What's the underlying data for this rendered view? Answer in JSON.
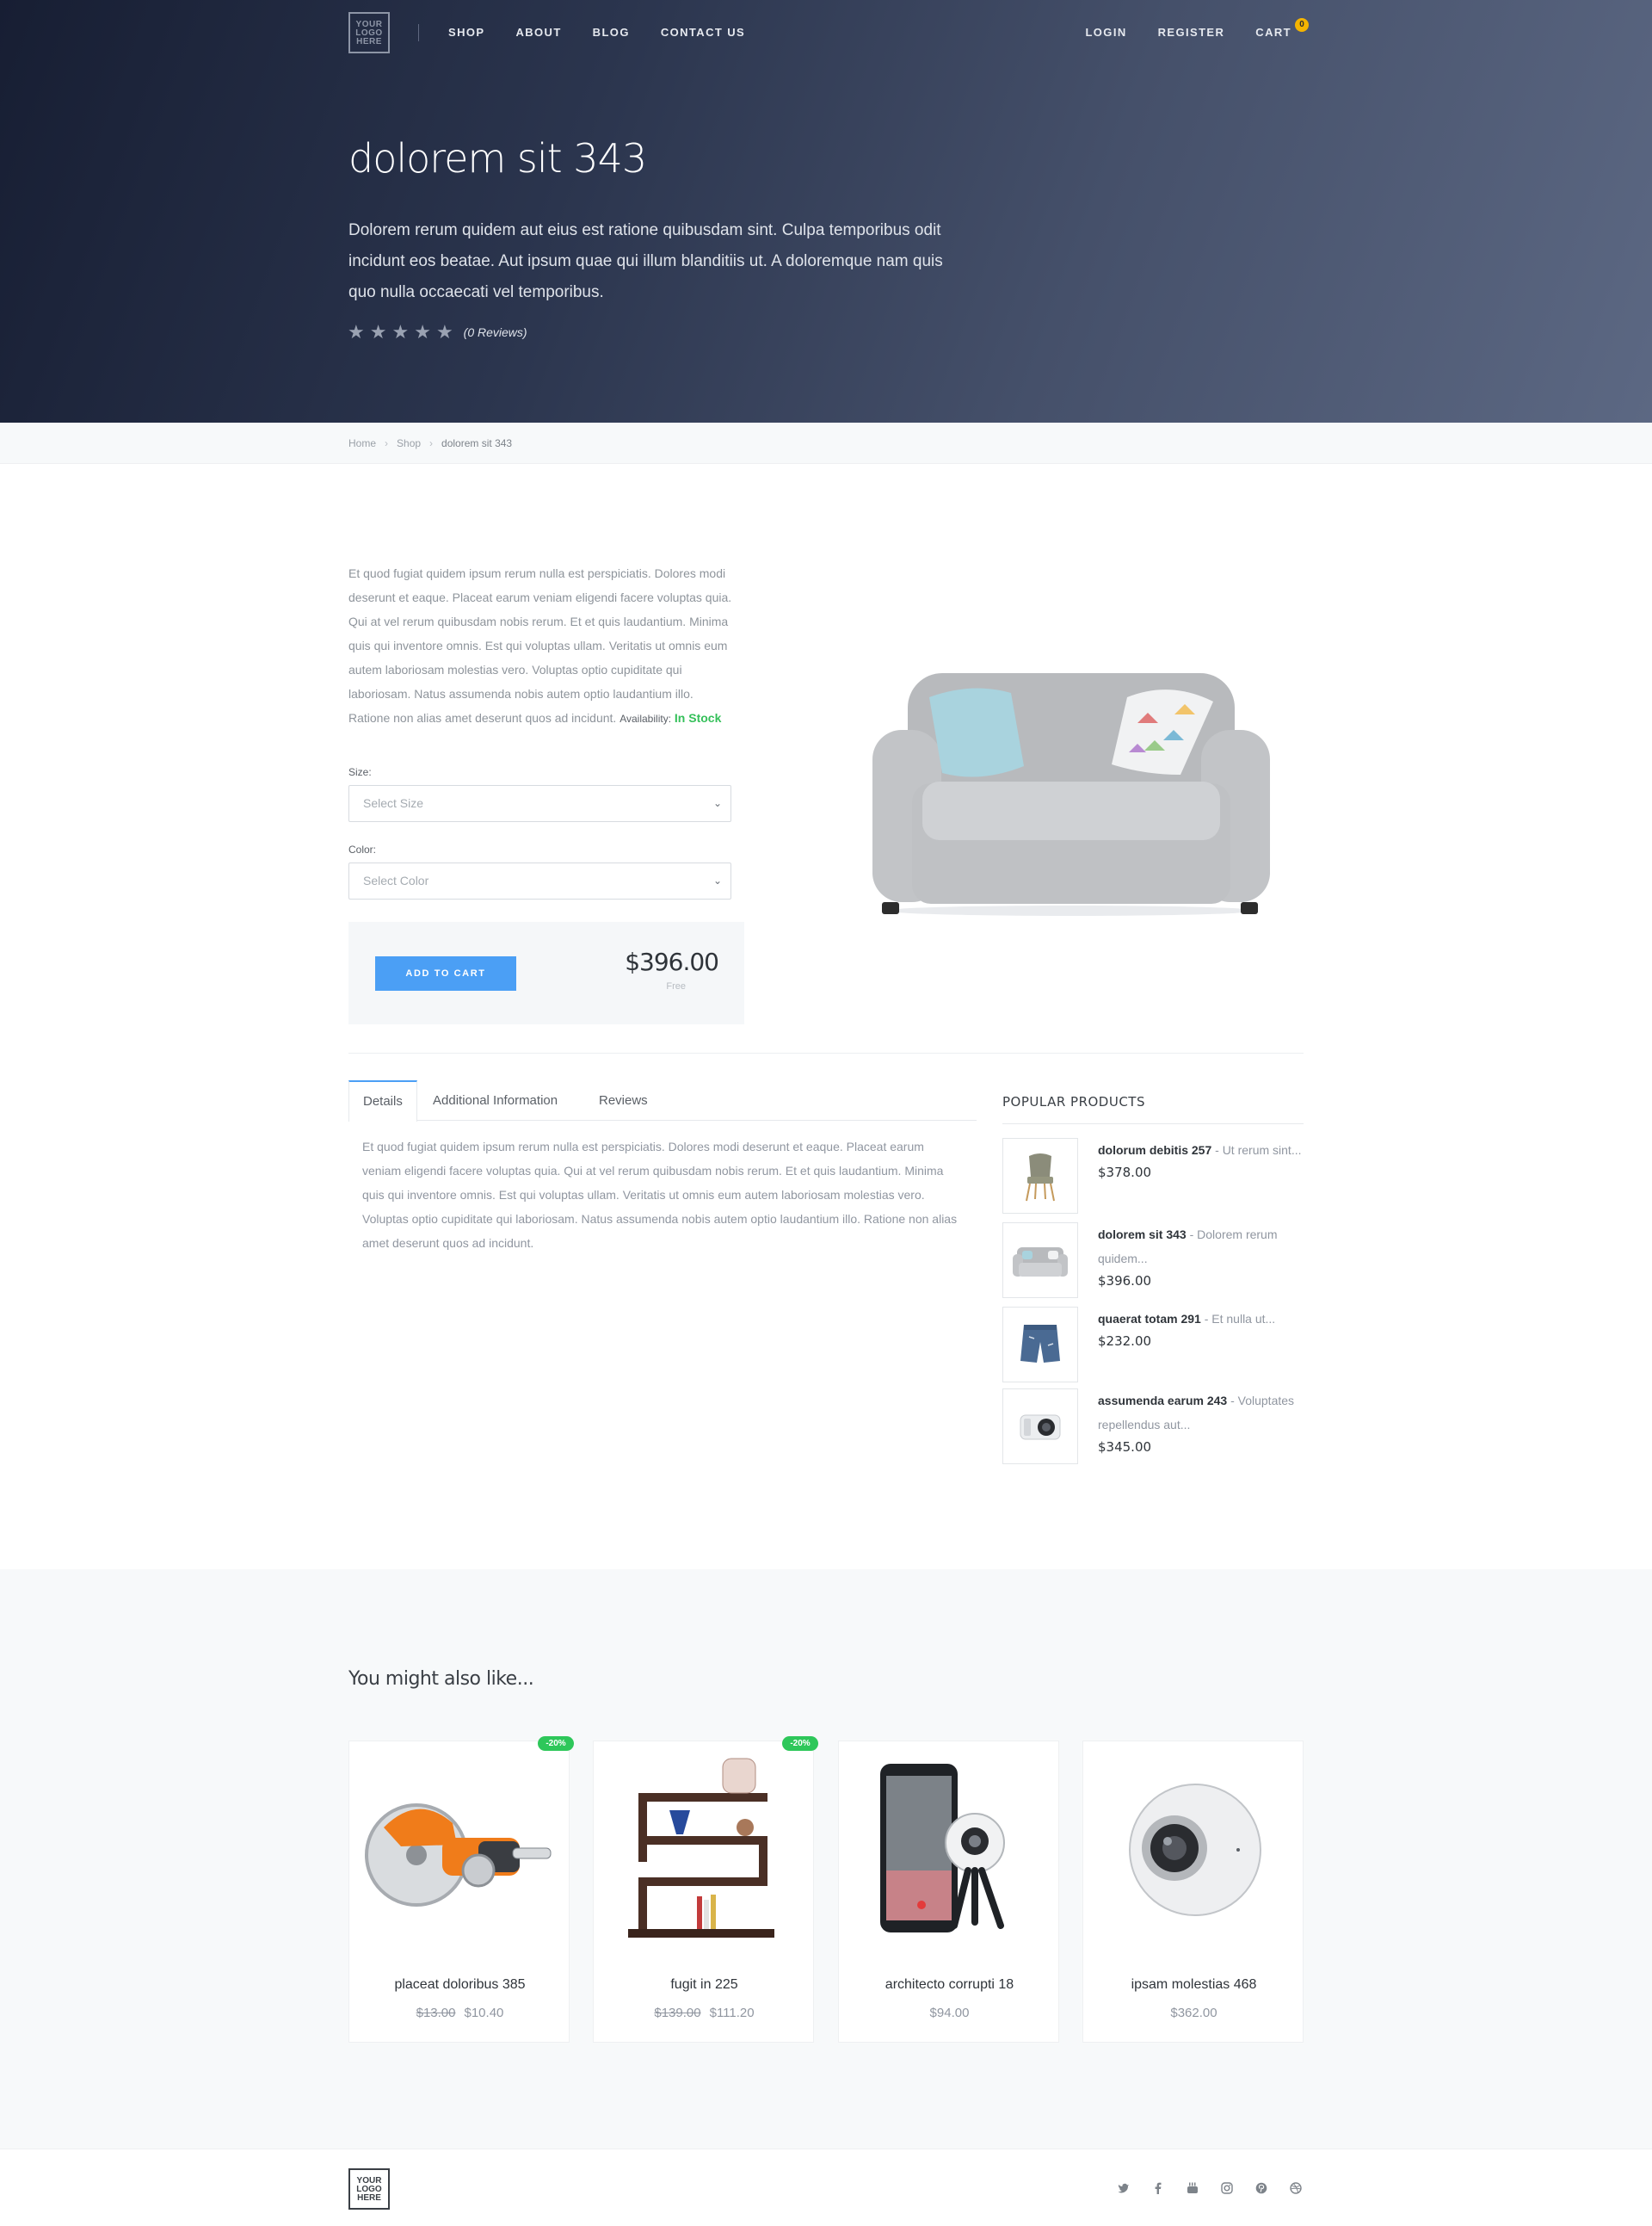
{
  "nav": {
    "logo_lines": [
      "YOUR",
      "LOGO",
      "HERE"
    ],
    "links": [
      "SHOP",
      "ABOUT",
      "BLOG",
      "CONTACT US"
    ],
    "login": "LOGIN",
    "register": "REGISTER",
    "cart": "CART",
    "cart_count": "0"
  },
  "hero": {
    "title": "dolorem sit 343",
    "description": "Dolorem rerum quidem aut eius est ratione quibusdam sint. Culpa temporibus odit incidunt eos beatae. Aut ipsum quae qui illum blanditiis ut. A doloremque nam quis quo nulla occaecati vel temporibus.",
    "rating_stars": 0,
    "reviews": "(0 Reviews)"
  },
  "breadcrumb": [
    "Home",
    "Shop",
    "dolorem sit 343"
  ],
  "product": {
    "description": "Et quod fugiat quidem ipsum rerum nulla est perspiciatis. Dolores modi deserunt et eaque. Placeat earum veniam eligendi facere voluptas quia. Qui at vel rerum quibusdam nobis rerum. Et et quis laudantium. Minima quis qui inventore omnis. Est qui voluptas ullam. Veritatis ut omnis eum autem laboriosam molestias vero. Voluptas optio cupiditate qui laboriosam. Natus assumenda nobis autem optio laudantium illo. Ratione non alias amet deserunt quos ad incidunt.",
    "availability_label": "Availability:",
    "availability_value": "In Stock",
    "size_label": "Size:",
    "size_placeholder": "Select Size",
    "color_label": "Color:",
    "color_placeholder": "Select Color",
    "add_to_cart": "ADD TO CART",
    "price": "$396.00",
    "shipping": "Free"
  },
  "tabs": {
    "items": [
      "Details",
      "Additional Information",
      "Reviews"
    ],
    "active": "Details",
    "content": "Et quod fugiat quidem ipsum rerum nulla est perspiciatis. Dolores modi deserunt et eaque. Placeat earum veniam eligendi facere voluptas quia. Qui at vel rerum quibusdam nobis rerum. Et et quis laudantium. Minima quis qui inventore omnis. Est qui voluptas ullam. Veritatis ut omnis eum autem laboriosam molestias vero. Voluptas optio cupiditate qui laboriosam. Natus assumenda nobis autem optio laudantium illo. Ratione non alias amet deserunt quos ad incidunt."
  },
  "popular": {
    "title": "POPULAR PRODUCTS",
    "items": [
      {
        "name": "dolorum debitis 257",
        "excerpt": " - Ut rerum sint...",
        "price": "$378.00",
        "icon": "chair-icon"
      },
      {
        "name": "dolorem sit 343",
        "excerpt": " - Dolorem rerum quidem...",
        "price": "$396.00",
        "icon": "sofa-icon"
      },
      {
        "name": "quaerat totam 291",
        "excerpt": " - Et nulla ut...",
        "price": "$232.00",
        "icon": "shorts-icon"
      },
      {
        "name": "assumenda earum 243",
        "excerpt": " - Voluptates repellendus aut...",
        "price": "$345.00",
        "icon": "camera-icon"
      }
    ]
  },
  "related": {
    "title": "You might also like...",
    "items": [
      {
        "name": "placeat doloribus 385",
        "old_price": "$13.00",
        "price": "$10.40",
        "badge": "-20%",
        "icon": "saw-icon"
      },
      {
        "name": "fugit in 225",
        "old_price": "$139.00",
        "price": "$111.20",
        "badge": "-20%",
        "icon": "shelf-icon"
      },
      {
        "name": "architecto corrupti 18",
        "old_price": "",
        "price": "$94.00",
        "badge": "",
        "icon": "phone-camera-icon"
      },
      {
        "name": "ipsam molestias 468",
        "old_price": "",
        "price": "$362.00",
        "badge": "",
        "icon": "360-camera-icon"
      }
    ]
  },
  "footer": {
    "logo_lines": [
      "YOUR",
      "LOGO",
      "HERE"
    ],
    "socials": [
      "twitter-icon",
      "facebook-icon",
      "youtube-icon",
      "instagram-icon",
      "pinterest-icon",
      "dribbble-icon"
    ]
  },
  "colors": {
    "accent": "#4b9ff5",
    "in_stock": "#35c05a",
    "sale_badge": "#2ec75a",
    "cart_badge": "#f4b400"
  }
}
